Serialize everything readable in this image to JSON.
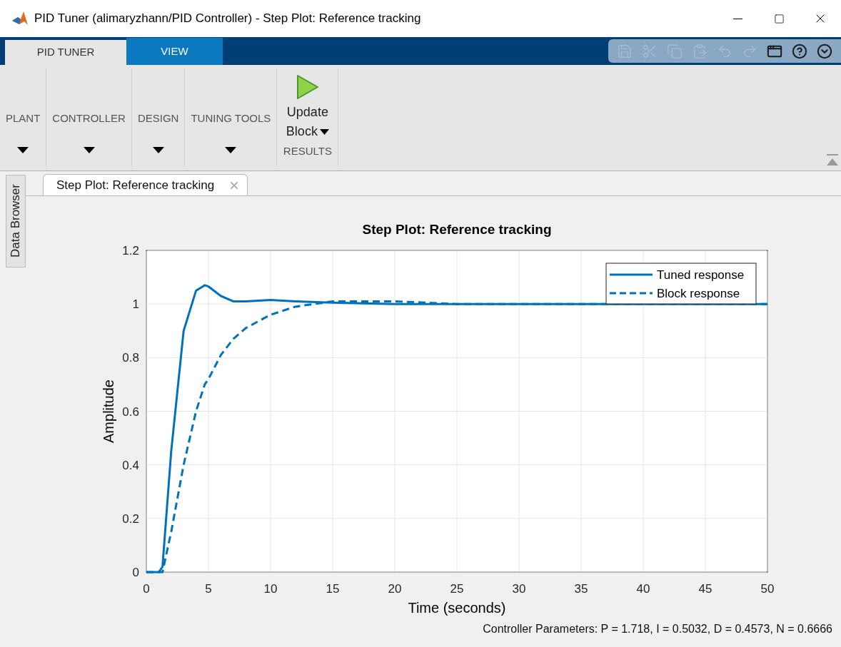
{
  "window": {
    "title": "PID Tuner (alimaryzhann/PID Controller) - Step Plot: Reference tracking"
  },
  "tabs": [
    {
      "label": "PID TUNER",
      "selected": true
    },
    {
      "label": "VIEW",
      "selected": false
    }
  ],
  "quick_access": [
    {
      "kind": "save",
      "disabled": true
    },
    {
      "kind": "cut",
      "disabled": true
    },
    {
      "kind": "copy",
      "disabled": true
    },
    {
      "kind": "paste",
      "disabled": true
    },
    {
      "kind": "undo",
      "disabled": true
    },
    {
      "kind": "redo",
      "disabled": true
    },
    {
      "kind": "layout",
      "disabled": false
    },
    {
      "kind": "help",
      "disabled": false
    },
    {
      "kind": "more",
      "disabled": false
    }
  ],
  "ribbon": {
    "sections": [
      {
        "label": "PLANT"
      },
      {
        "label": "CONTROLLER"
      },
      {
        "label": "DESIGN"
      },
      {
        "label": "TUNING TOOLS"
      }
    ],
    "results": {
      "button_lines": [
        "Update",
        "Block"
      ],
      "section_label": "RESULTS"
    }
  },
  "side_tab": {
    "label": "Data Browser"
  },
  "document_tabs": [
    {
      "label": "Step Plot: Reference tracking",
      "selected": true
    }
  ],
  "plot": {
    "chart_data": {
      "type": "line",
      "title": "Step Plot: Reference tracking",
      "xlabel": "Time (seconds)",
      "ylabel": "Amplitude",
      "x": [
        0,
        1,
        1.3,
        2,
        3,
        4,
        4.7,
        5,
        6,
        7,
        8,
        10,
        12,
        15,
        20,
        25,
        30,
        40,
        50
      ],
      "series": [
        {
          "name": "Tuned response",
          "color": "#0072bd",
          "line_style": "solid",
          "values": [
            0,
            0,
            0.02,
            0.45,
            0.9,
            1.05,
            1.07,
            1.065,
            1.03,
            1.01,
            1.01,
            1.015,
            1.01,
            1.005,
            1,
            1,
            1,
            1,
            1
          ]
        },
        {
          "name": "Block response",
          "color": "#0072bd",
          "line_style": "dashed",
          "values": [
            0,
            0,
            0,
            0.15,
            0.4,
            0.6,
            0.7,
            0.72,
            0.81,
            0.87,
            0.91,
            0.96,
            0.99,
            1.01,
            1.01,
            1,
            1,
            1,
            1
          ]
        }
      ],
      "grid": true,
      "legend": true,
      "xlim": [
        0,
        50
      ],
      "ylim": [
        0,
        1.2
      ],
      "xticks": [
        0,
        5,
        10,
        15,
        20,
        25,
        30,
        35,
        40,
        45,
        50
      ],
      "yticks": [
        0,
        0.2,
        0.4,
        0.6,
        0.8,
        1,
        1.2
      ]
    }
  },
  "status_bar": {
    "text": "Controller Parameters: P = 1.718, I = 0.5032, D = 0.4573, N = 0.6666"
  }
}
